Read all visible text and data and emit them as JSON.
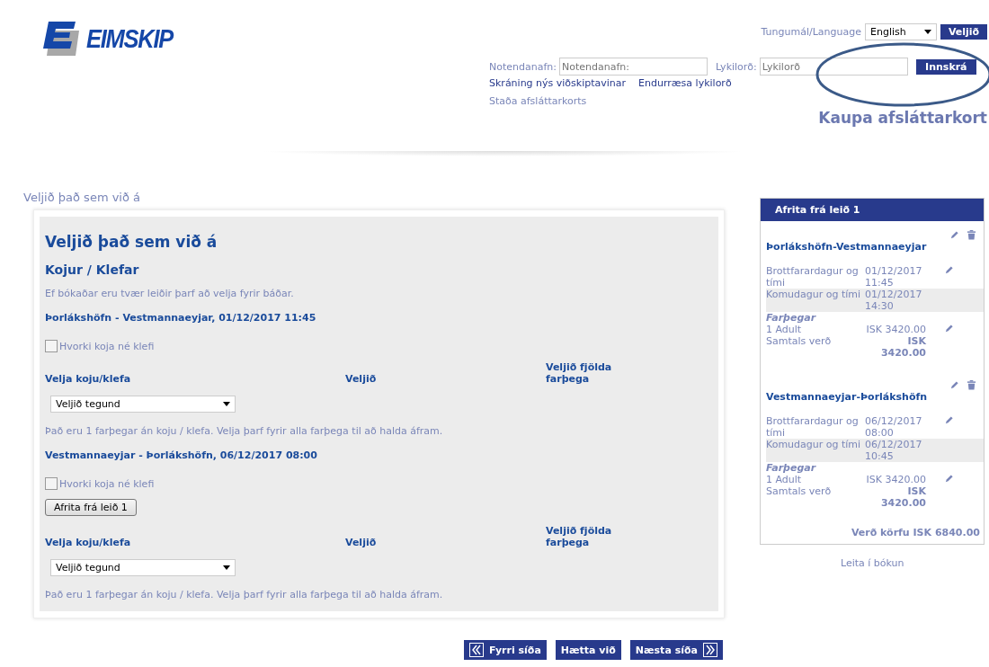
{
  "logo": {
    "text": "EIMSKIP"
  },
  "language": {
    "label": "Tungumál/Language",
    "value": "English",
    "button": "Veljið"
  },
  "login": {
    "username_label": "Notendanafn:",
    "username_placeholder": "Notendanafn:",
    "password_label": "Lykilorð:",
    "password_placeholder": "Lykilorð",
    "button": "Innskrá"
  },
  "links": [
    "Skráning nýs viðskiptavinar",
    "Endurræsa lykilorð"
  ],
  "card_status_link": "Staða afsláttarkorts",
  "buy_card_link": "Kaupa afsláttarkort",
  "breadcrumb": "Veljið það sem við á",
  "form": {
    "title": "Veljið það sem við á",
    "subtitle": "Kojur / Klefar",
    "note": "Ef bókaðar eru tvær leiðir þarf að velja fyrir báðar.",
    "legs": [
      {
        "heading": "Þorlákshöfn - Vestmannaeyjar, 01/12/2017 11:45",
        "none_checkbox": {
          "label": "Hvorki koja né klefi",
          "checked": false
        },
        "columns": [
          "Velja koju/klefa",
          "Veljið",
          "Veljið fjölda farþega"
        ],
        "select": "Veljið tegund",
        "warning": "Það eru 1 farþegar án koju / klefa. Velja þarf fyrir alla farþega til að halda áfram."
      },
      {
        "heading": "Vestmannaeyjar - Þorlákshöfn, 06/12/2017 08:00",
        "none_checkbox": {
          "label": "Hvorki koja né klefi",
          "checked": false
        },
        "copy_button": "Afrita frá leið 1",
        "columns": [
          "Velja koju/klefa",
          "Veljið",
          "Veljið fjölda farþega"
        ],
        "select": "Veljið tegund",
        "warning": "Það eru 1 farþegar án koju / klefa. Velja þarf fyrir alla farþega til að halda áfram."
      }
    ]
  },
  "basket": {
    "header": "Afrita frá leið 1",
    "legs": [
      {
        "title": "Þorlákshöfn-Vestmannaeyjar",
        "rows": [
          {
            "label": "Brottfarardagur og tími",
            "value": "01/12/2017 11:45",
            "editable": true,
            "shaded": false
          },
          {
            "label": "Komudagur og tími",
            "value": "01/12/2017 14:30",
            "editable": false,
            "shaded": true
          }
        ],
        "passengers_heading": "Farþegar",
        "passengers": [
          {
            "label": "1 Adult",
            "value": "ISK 3420.00",
            "editable": true
          }
        ],
        "total_label": "Samtals verð",
        "total": "ISK 3420.00"
      },
      {
        "title": "Vestmannaeyjar-Þorlákshöfn",
        "rows": [
          {
            "label": "Brottfarardagur og tími",
            "value": "06/12/2017 08:00",
            "editable": true,
            "shaded": false
          },
          {
            "label": "Komudagur og tími",
            "value": "06/12/2017 10:45",
            "editable": false,
            "shaded": true
          }
        ],
        "passengers_heading": "Farþegar",
        "passengers": [
          {
            "label": "1 Adult",
            "value": "ISK 3420.00",
            "editable": true
          }
        ],
        "total_label": "Samtals verð",
        "total": "ISK 3420.00"
      }
    ],
    "total": "Verð körfu ISK 6840.00"
  },
  "search_link": "Leita í bókun",
  "nav_buttons": [
    {
      "label": "Fyrri síða",
      "kind": "prev"
    },
    {
      "label": "Hætta við",
      "kind": "plain"
    },
    {
      "label": "Næsta síða",
      "kind": "next"
    }
  ]
}
